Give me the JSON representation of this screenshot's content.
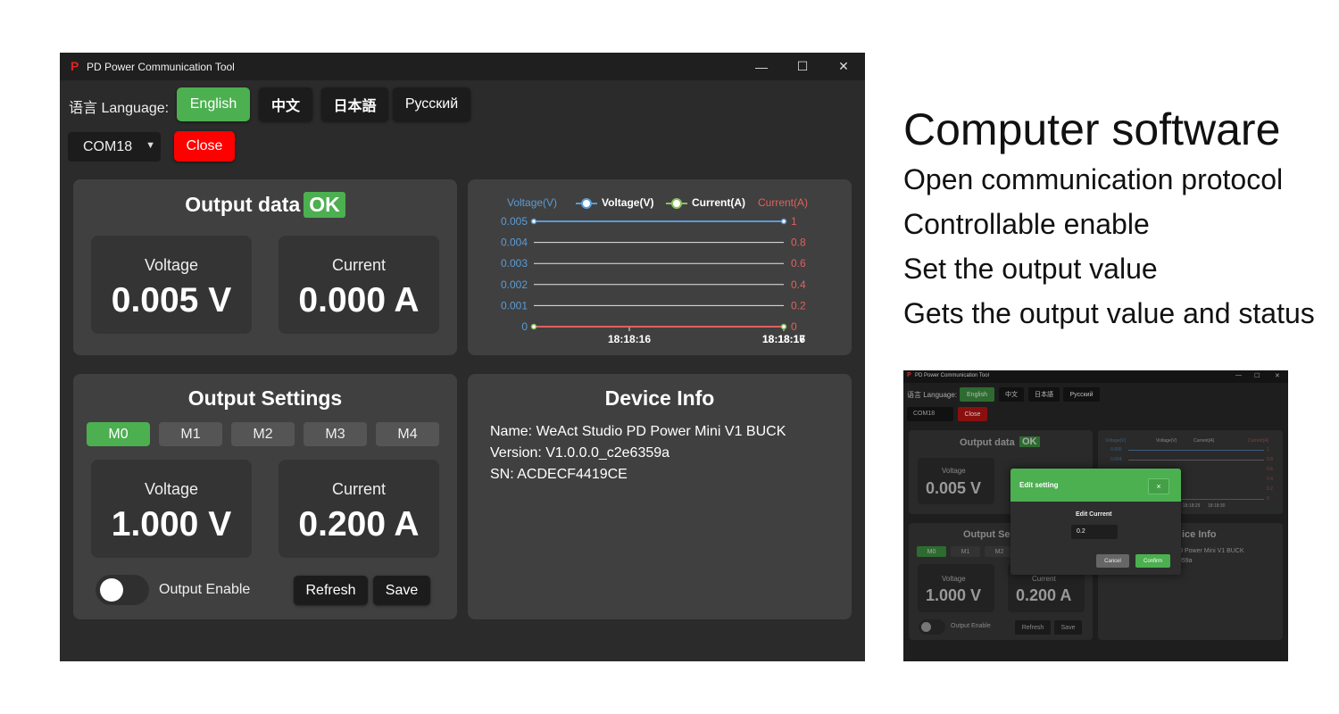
{
  "window": {
    "title": "PD Power Communication Tool",
    "app_icon": "P",
    "controls": {
      "minimize": "—",
      "maximize": "☐",
      "close": "✕"
    }
  },
  "language": {
    "label": "语言 Language:",
    "options": [
      "English",
      "中文",
      "日本語",
      "Русский"
    ],
    "selected": "English"
  },
  "port": {
    "selected": "COM18",
    "close_label": "Close"
  },
  "output_data": {
    "title": "Output data",
    "status": "OK",
    "voltage_label": "Voltage",
    "voltage_value": "0.005 V",
    "current_label": "Current",
    "current_value": "0.000 A"
  },
  "chart_data": {
    "type": "line",
    "legend": [
      "Voltage(V)",
      "Current(A)"
    ],
    "y_left_label": "Voltage(V)",
    "y_right_label": "Current(A)",
    "y_left_ticks": [
      "0.005",
      "0.004",
      "0.003",
      "0.002",
      "0.001",
      "0"
    ],
    "y_right_ticks": [
      "1",
      "0.8",
      "0.6",
      "0.4",
      "0.2",
      "0"
    ],
    "ylim_left": [
      0,
      0.005
    ],
    "ylim_right": [
      0,
      1
    ],
    "x_ticks": [
      "18:18:16",
      "18:18:17"
    ],
    "x_ticks_overlay": "18:18:16",
    "series": [
      {
        "name": "Voltage(V)",
        "color": "#5b9bd5",
        "x": [
          "18:18:15",
          "18:18:17"
        ],
        "values": [
          0.005,
          0.005
        ]
      },
      {
        "name": "Current(A)",
        "color": "#e06060",
        "x": [
          "18:18:15",
          "18:18:17"
        ],
        "values": [
          0,
          0
        ]
      }
    ]
  },
  "output_settings": {
    "title": "Output Settings",
    "modes": [
      "M0",
      "M1",
      "M2",
      "M3",
      "M4"
    ],
    "active_mode": "M0",
    "voltage_label": "Voltage",
    "voltage_value": "1.000 V",
    "current_label": "Current",
    "current_value": "0.200 A",
    "enable_label": "Output Enable",
    "enabled": false,
    "refresh_label": "Refresh",
    "save_label": "Save"
  },
  "device_info": {
    "title": "Device Info",
    "lines": [
      "Name: WeAct Studio PD Power Mini V1 BUCK",
      "Version: V1.0.0.0_c2e6359a",
      "SN: ACDECF4419CE"
    ]
  },
  "marketing": {
    "heading": "Computer software",
    "lines": [
      "Open communication protocol",
      "Controllable enable",
      "Set the output value",
      "Gets the output value and status"
    ]
  },
  "thumbnail": {
    "window_title": "PD Power Communication Tool",
    "lang_label": "语言 Language:",
    "languages": [
      "English",
      "中文",
      "日本語",
      "Русский"
    ],
    "port": "COM18",
    "close_label": "Close",
    "output_data_title": "Output data",
    "ok": "OK",
    "voltage_label": "Voltage",
    "voltage_value": "0.005 V",
    "chart_legend": [
      "Voltage(V)",
      "Voltage(V)",
      "Current(A)",
      "Current(A)"
    ],
    "chart_left_ticks": [
      "0.005",
      "0.004"
    ],
    "chart_right_ticks": [
      "1",
      "0.8",
      "0.6",
      "0.4",
      "0.2",
      "0"
    ],
    "chart_x_ticks": [
      "18:18:29",
      "18:18:30"
    ],
    "output_settings_partial": "Output Se",
    "modes": [
      "M0",
      "M1",
      "M2"
    ],
    "settings_voltage_label": "Voltage",
    "settings_voltage_value": "1.000 V",
    "settings_current_label": "Current",
    "settings_current_value": "0.200 A",
    "enable_label": "Output Enable",
    "refresh_label": "Refresh",
    "save_label": "Save",
    "device_info_partial": "ice Info",
    "device_name_partial": "D Power Mini V1 BUCK",
    "device_version_partial": "359a",
    "dialog": {
      "title": "Edit setting",
      "close": "×",
      "field_label": "Edit Current",
      "field_value": "0.2",
      "cancel_label": "Cancel",
      "confirm_label": "Confirm"
    }
  }
}
